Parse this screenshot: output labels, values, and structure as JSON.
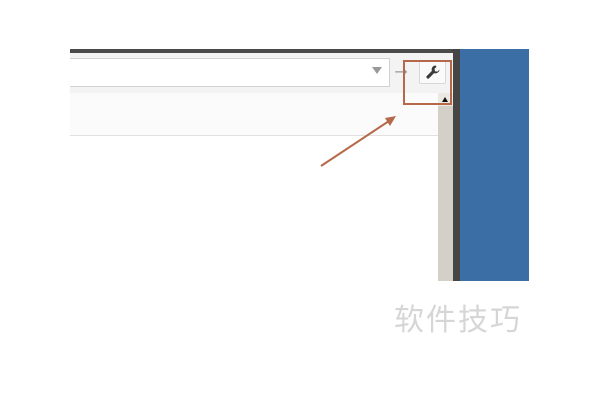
{
  "toolbar": {
    "dropdown_icon": "chevron-down-icon",
    "go_icon": "arrow-right-icon",
    "go_glyph": "→",
    "tools_icon": "wrench-icon"
  },
  "scrollbar": {
    "up_icon": "triangle-up-icon"
  },
  "annotation": {
    "color": "#b5694a"
  },
  "desktop": {
    "color": "#3a6ea5"
  },
  "watermark": {
    "text": "软件技巧"
  }
}
